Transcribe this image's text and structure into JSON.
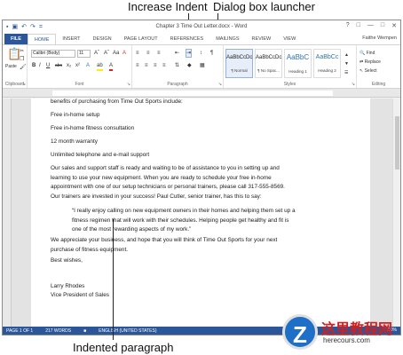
{
  "callouts": {
    "top_left": "Increase Indent",
    "top_right": "Dialog box launcher",
    "bottom": "Indented paragraph"
  },
  "window": {
    "title": "Chapter 3 Time Out Letter.docx - Word",
    "controls": [
      "?",
      "□",
      "—",
      "□",
      "✕"
    ],
    "qat": [
      "▪",
      "↶",
      "↷",
      "="
    ]
  },
  "tabs": [
    "FILE",
    "HOME",
    "INSERT",
    "DESIGN",
    "PAGE LAYOUT",
    "REFERENCES",
    "MAILINGS",
    "REVIEW",
    "VIEW"
  ],
  "active_tab": "HOME",
  "user": "Faithe Wempen",
  "ribbon": {
    "clipboard": {
      "label": "Clipboard",
      "paste": "Paste"
    },
    "font": {
      "label": "Font",
      "family": "Calibri (Body)",
      "size": "11",
      "bold": "B",
      "italic": "I",
      "underline": "U",
      "strike": "abc",
      "sub": "x₂",
      "sup": "x²"
    },
    "paragraph": {
      "label": "Paragraph"
    },
    "styles": {
      "label": "Styles",
      "items": [
        {
          "preview": "AaBbCcDc",
          "name": "¶ Normal",
          "selected": true
        },
        {
          "preview": "AaBbCcDc",
          "name": "¶ No Spac...",
          "selected": false
        },
        {
          "preview": "AaBbC",
          "name": "Heading 1",
          "selected": false
        },
        {
          "preview": "AaBbCc",
          "name": "Heading 2",
          "selected": false
        }
      ]
    },
    "editing": {
      "label": "Editing",
      "find": "Find",
      "replace": "Replace",
      "select": "Select"
    }
  },
  "document": {
    "paragraphs": [
      {
        "text": "benefits of purchasing from Time Out Sports include:",
        "indent": false
      },
      {
        "text": "Free in-home setup",
        "indent": false
      },
      {
        "text": "Free in-home fitness consultation",
        "indent": false
      },
      {
        "text": "12 month warranty",
        "indent": false
      },
      {
        "text": "Unlimited telephone and e-mail support",
        "indent": false
      },
      {
        "text": "Our sales and support staff is ready and waiting to be of assistance to you in setting up and learning to use your new equipment.  When you are ready to schedule your free in-home appointment with one of our setup technicians or personal trainers, please call 317-555-8569.",
        "indent": false
      },
      {
        "text": "Our trainers are invested in your success!  Paul Cutler, senior trainer, has this to say:",
        "indent": false
      },
      {
        "text": "“I really enjoy calling on new equipment owners in their homes and helping them set up a fitness regimen that will work with their schedules. Helping people get healthy and fit is one of the most rewarding aspects of my work.”",
        "indent": true
      },
      {
        "text": "We appreciate your business, and hope that you will think of Time Out Sports for your next purchase of fitness equipment.",
        "indent": false
      },
      {
        "text": "Best wishes,",
        "indent": false
      },
      {
        "text": "Larry Rhodes",
        "indent": false
      },
      {
        "text": "Vice President of Sales",
        "indent": false
      }
    ]
  },
  "status": {
    "page": "PAGE 1 OF 1",
    "words": "217 WORDS",
    "language": "ENGLISH (UNITED STATES)",
    "zoom": "100%"
  },
  "watermark": {
    "logo": "Z",
    "text": "这里教程网",
    "url": "herecours.com"
  },
  "colors": {
    "accent": "#2b579a",
    "watermark_red": "#d21f1f",
    "watermark_blue": "#1e6fc8"
  }
}
